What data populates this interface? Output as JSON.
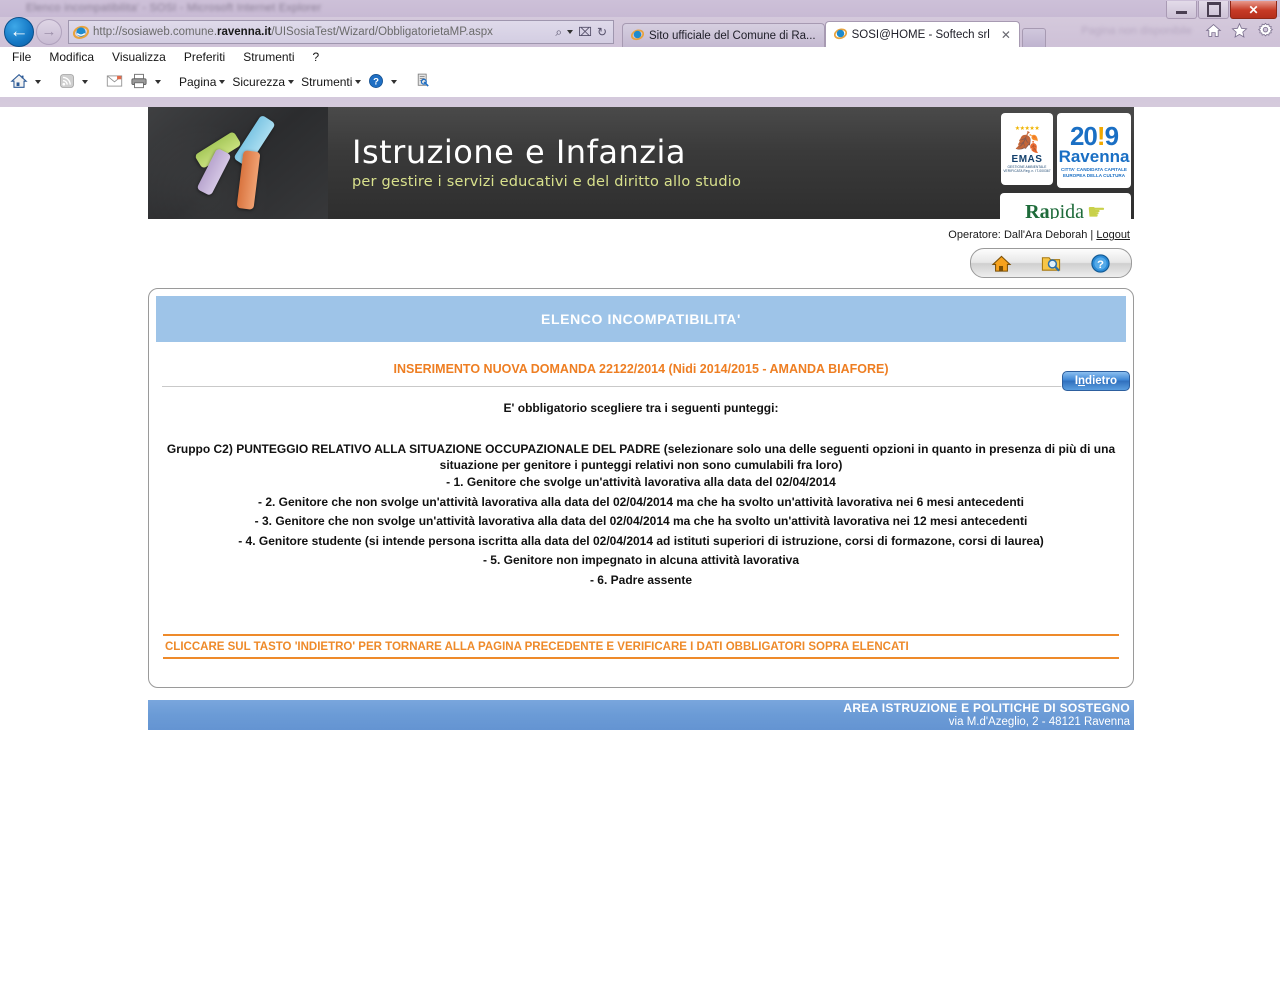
{
  "window": {
    "title": "Elenco incompatibilita' - SOSI - Microsoft Internet Explorer",
    "minimize_label": "Riduci a icona",
    "maximize_label": "Ripristina",
    "close_label": "Chiudi"
  },
  "browser": {
    "back_glyph": "←",
    "forward_glyph": "→",
    "url_protocol": "http://sosiaweb.comune.",
    "url_domain": "ravenna.it",
    "url_path": "/UISosiaTest/Wizard/ObbligatorietaMP.aspx",
    "url_full": "http://sosiaweb.comune.ravenna.it/UISosiaTest/Wizard/ObbligatorietaMP.aspx",
    "search_icon": "⌕",
    "compat_icon": "⌧",
    "refresh_icon": "↻",
    "tabs": [
      {
        "label": "Sito ufficiale del Comune di Ra...",
        "active": false,
        "close": ""
      },
      {
        "label": "SOSI@HOME - Softech srl",
        "active": true,
        "close": "✕"
      }
    ],
    "chrome_right_blur": "Pagina non disponibile",
    "home_icon_name": "home-icon",
    "star_icon_name": "favorites-star-icon",
    "gear_icon_name": "tools-gear-icon",
    "menu": [
      "File",
      "Modifica",
      "Visualizza",
      "Preferiti",
      "Strumenti",
      "?"
    ],
    "command_bar": {
      "home": "home-icon",
      "feeds": "rss-feed-icon",
      "mail": "mail-icon",
      "print": "printer-icon",
      "page_label": "Pagina",
      "security_label": "Sicurezza",
      "tools_label": "Strumenti",
      "help": "help-icon",
      "compat": "compatibility-view-icon"
    }
  },
  "banner": {
    "title": "Istruzione e Infanzia",
    "subtitle": "per gestire i servizi educativi e del diritto allo studio",
    "logos": {
      "emas_stars": "★★★★★",
      "emas_word": "EMAS",
      "emas_caption": "GESTIONE AMBIENTALE VERIFICATA\nReg. n. IT-000367",
      "year_main": "20",
      "year_dot": "!",
      "year_end": "9",
      "city": "Ravenna",
      "city_caption": "CITTA' CANDIDATA\nCAPITALE EUROPEA\nDELLA CULTURA",
      "rapida_bold": "Ra",
      "rapida_rest": "pida",
      "rapida_hand": "☛"
    }
  },
  "session": {
    "operator_label": "Operatore:",
    "operator_name": "Dall'Ara Deborah",
    "separator": "|",
    "logout_label": "Logout"
  },
  "toolbar": {
    "home_title": "Home",
    "search_title": "Ricerca",
    "help_title": "Guida"
  },
  "panel": {
    "header_title": "ELENCO INCOMPATIBILITA'",
    "subtitle": "INSERIMENTO NUOVA DOMANDA 22122/2014 (Nidi 2014/2015 - AMANDA BIAFORE)",
    "back_button_pre": "I",
    "back_button_accesskey": "n",
    "back_button_post": "dietro",
    "back_button_label": "Indietro",
    "mandatory_line": "E' obbligatorio scegliere tra i seguenti punteggi:",
    "group_title": "Gruppo C2) PUNTEGGIO RELATIVO ALLA SITUAZIONE OCCUPAZIONALE DEL PADRE (selezionare solo una delle seguenti opzioni in quanto in presenza di più di una situazione per genitore i punteggi relativi non sono cumulabili fra loro)",
    "options": [
      "- 1. Genitore che svolge un'attività lavorativa alla data del 02/04/2014",
      "- 2. Genitore che non svolge un'attività lavorativa alla data del 02/04/2014 ma che ha svolto un'attività lavorativa nei 6 mesi antecedenti",
      "- 3. Genitore che non svolge un'attività lavorativa alla data del 02/04/2014 ma che ha svolto un'attività lavorativa nei 12 mesi antecedenti",
      "- 4. Genitore studente (si intende persona iscritta alla data del 02/04/2014 ad istituti superiori di istruzione, corsi di formazone, corsi di laurea)",
      "- 5. Genitore non impegnato in alcuna attività lavorativa",
      "- 6. Padre assente"
    ],
    "warning": "CLICCARE SUL TASTO 'INDIETRO' PER TORNARE ALLA PAGINA PRECEDENTE E VERIFICARE I DATI OBBLIGATORI SOPRA ELENCATI"
  },
  "footer": {
    "line1": "AREA ISTRUZIONE E POLITICHE DI SOSTEGNO",
    "line2": "via M.d'Azeglio, 2 - 48121 Ravenna"
  },
  "colors": {
    "panel_header_blue": "#9ec4e8",
    "accent_orange": "#ee7e22",
    "warning_orange": "#ee8a2a",
    "footer_blue": "#6b9bd6",
    "banner_dark": "#3a3a3a"
  }
}
